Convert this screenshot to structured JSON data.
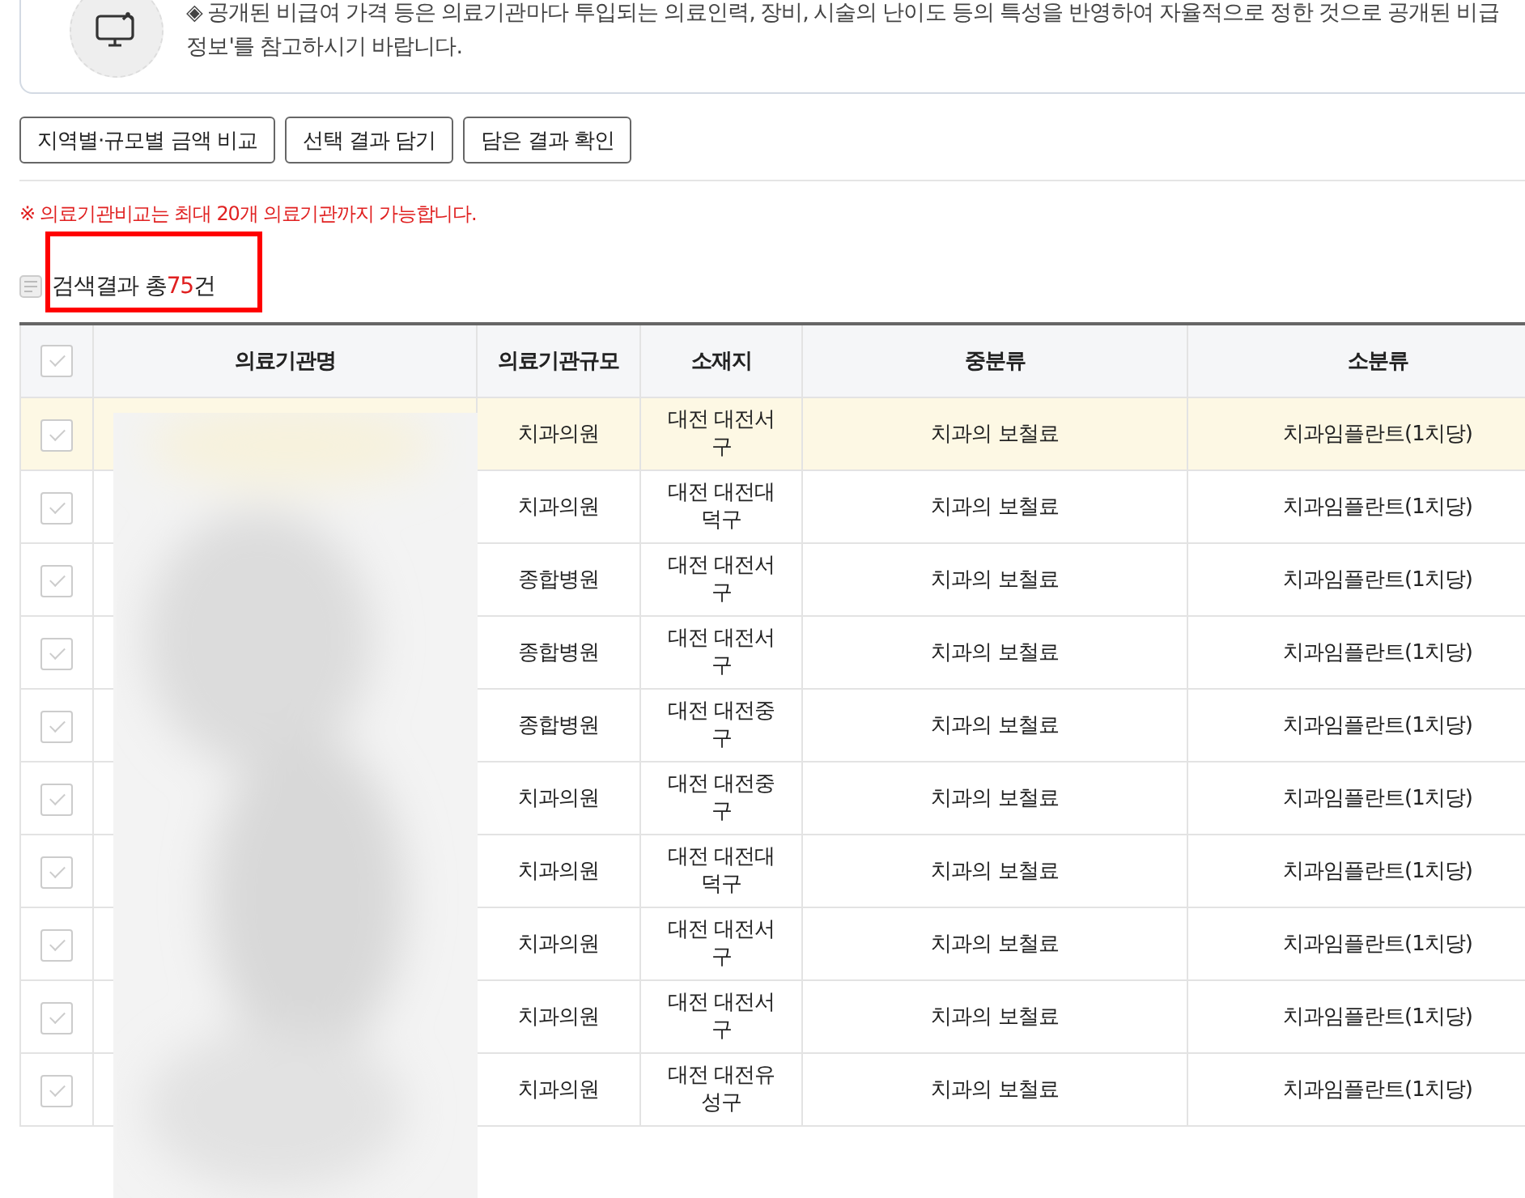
{
  "notice": {
    "lines": [
      "◈ 공개된 비급여 가격 등은 의료기관마다 투입되는 의료인력, 장비, 시술의 난이도 등의 특성을 반영하여 자율적으로 정한 것으로 공개된 비급",
      "정보'를 참고하시기 바랍니다."
    ]
  },
  "buttons": [
    "지역별·규모별 금액 비교",
    "선택 결과 담기",
    "담은 결과 확인"
  ],
  "warning": "※ 의료기관비교는 최대 20개 의료기관까지 가능합니다.",
  "result": {
    "label": "검색결과 총",
    "count": "75",
    "unit": "건",
    "highlighted": true
  },
  "table": {
    "header_checked": false,
    "columns": [
      "의료기관명",
      "의료기관규모",
      "소재지",
      "중분류",
      "소분류"
    ],
    "rows": [
      {
        "checked": false,
        "selected": true,
        "size": "치과의원",
        "location": "대전 대전서구",
        "middle": "치과의 보철료",
        "small": "치과임플란트(1치당)"
      },
      {
        "checked": false,
        "selected": false,
        "size": "치과의원",
        "location": "대전 대전대덕구",
        "middle": "치과의 보철료",
        "small": "치과임플란트(1치당)"
      },
      {
        "checked": false,
        "selected": false,
        "size": "종합병원",
        "location": "대전 대전서구",
        "middle": "치과의 보철료",
        "small": "치과임플란트(1치당)"
      },
      {
        "checked": false,
        "selected": false,
        "size": "종합병원",
        "location": "대전 대전서구",
        "middle": "치과의 보철료",
        "small": "치과임플란트(1치당)"
      },
      {
        "checked": false,
        "selected": false,
        "size": "종합병원",
        "location": "대전 대전중구",
        "middle": "치과의 보철료",
        "small": "치과임플란트(1치당)"
      },
      {
        "checked": false,
        "selected": false,
        "size": "치과의원",
        "location": "대전 대전중구",
        "middle": "치과의 보철료",
        "small": "치과임플란트(1치당)"
      },
      {
        "checked": false,
        "selected": false,
        "size": "치과의원",
        "location": "대전 대전대덕구",
        "middle": "치과의 보철료",
        "small": "치과임플란트(1치당)"
      },
      {
        "checked": false,
        "selected": false,
        "size": "치과의원",
        "location": "대전 대전서구",
        "middle": "치과의 보철료",
        "small": "치과임플란트(1치당)"
      },
      {
        "checked": false,
        "selected": false,
        "size": "치과의원",
        "location": "대전 대전서구",
        "middle": "치과의 보철료",
        "small": "치과임플란트(1치당)"
      },
      {
        "checked": false,
        "selected": false,
        "size": "치과의원",
        "location": "대전 대전유성구",
        "middle": "치과의 보철료",
        "small": "치과임플란트(1치당)"
      }
    ]
  }
}
